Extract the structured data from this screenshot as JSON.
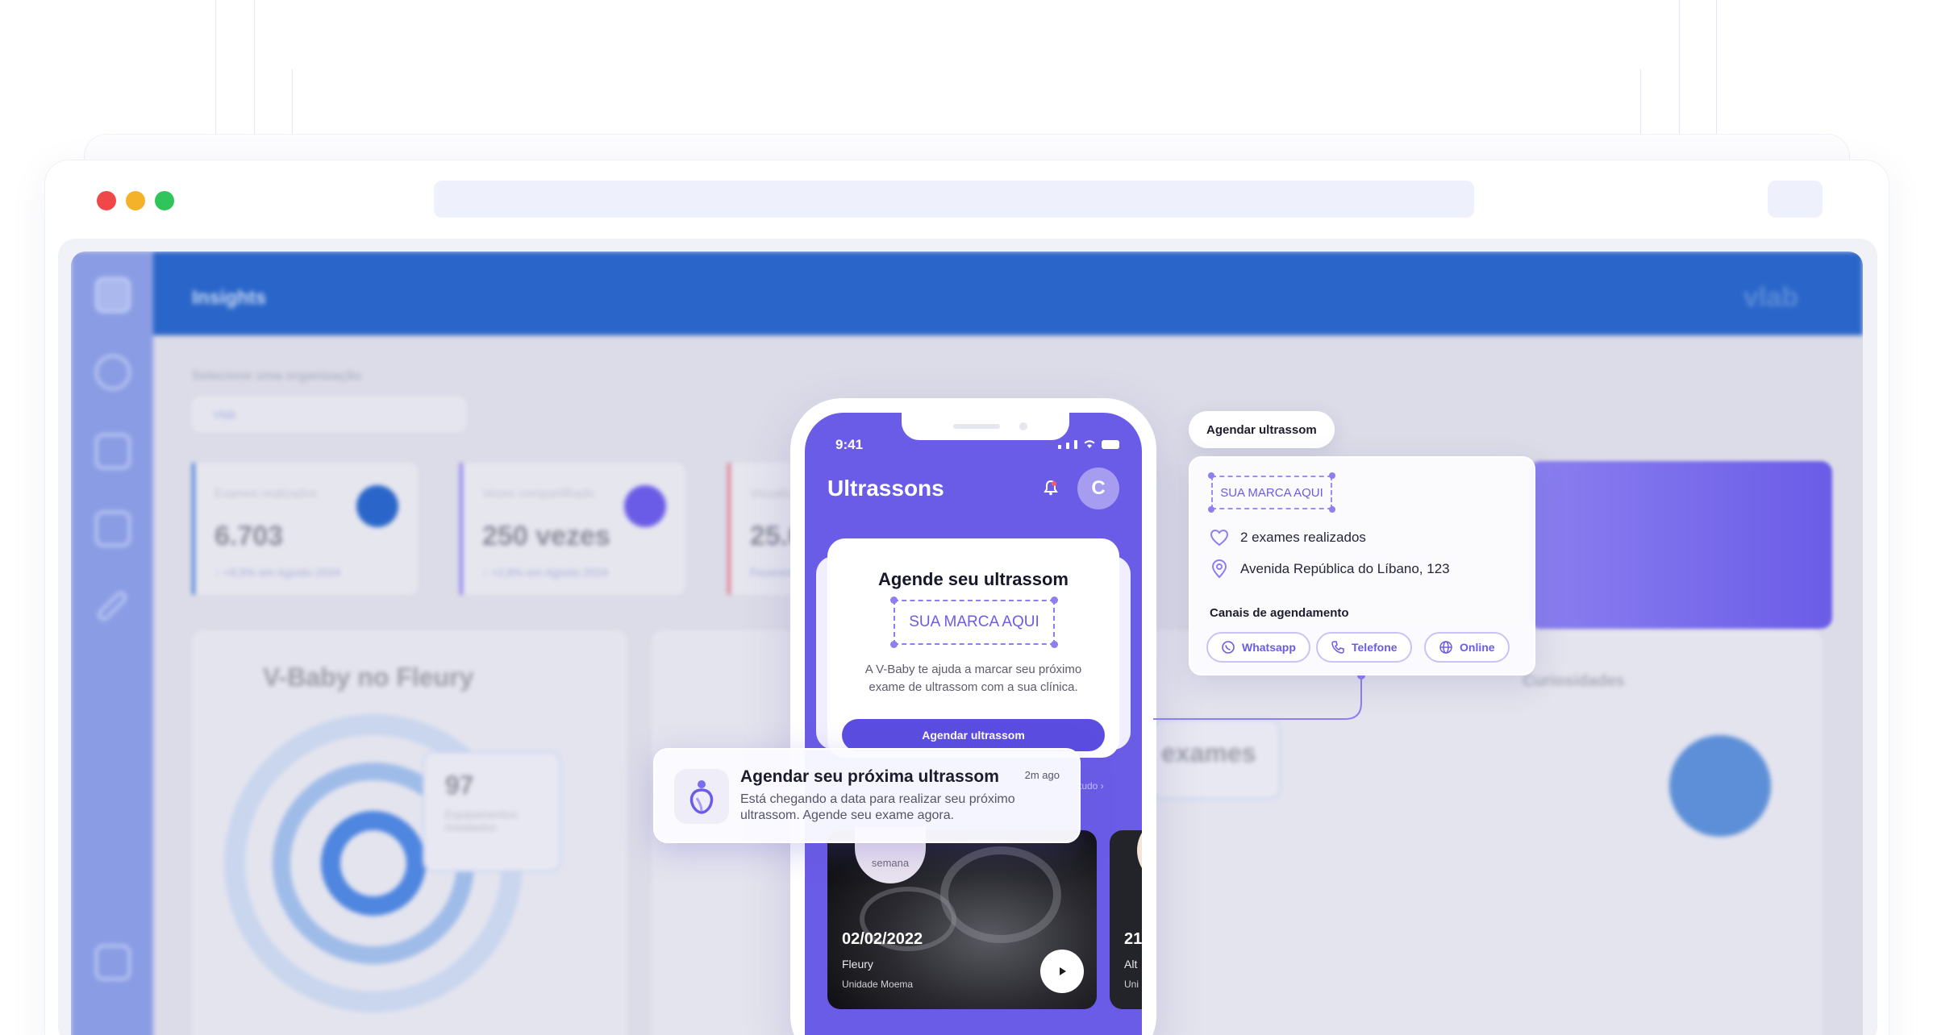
{
  "window": {
    "traffic_lights": [
      "#f04848",
      "#f4b22a",
      "#2fc55a"
    ]
  },
  "dashboard": {
    "header_title": "Insights",
    "header_logo": "vlab",
    "org_label": "Selecione uma organização",
    "org_value": "Vlab",
    "cards": [
      {
        "label": "Exames realizados",
        "value": "6.703",
        "trend": "↑ +8,5% em Agosto 2024",
        "accent": "#2a66c9"
      },
      {
        "label": "Vezes compartilhado",
        "value": "250 vezes",
        "trend": "↑ +2,8% em Agosto 2024",
        "accent": "#6b5ce7"
      },
      {
        "label": "Visualizações",
        "value": "25.0",
        "trend": "Fevereiro",
        "accent": "#e0556b"
      }
    ],
    "chart_title": "V-Baby no Fleury",
    "equip_value": "97",
    "equip_label": "Equipamentos instalados",
    "exams_heading": "exames",
    "curiosities_title": "Curiosidades"
  },
  "phone": {
    "time": "9:41",
    "title": "Ultrassons",
    "avatar_letter": "C",
    "card": {
      "title": "Agende seu ultrassom",
      "brand_placeholder": "SUA MARCA AQUI",
      "description": "A V-Baby te ajuda a marcar seu próximo exame de ultrassom com a sua clínica.",
      "cta": "Agendar ultrassom"
    },
    "see_all": "tudo ›",
    "videos": [
      {
        "week": "semana",
        "date": "02/02/2022",
        "place": "Fleury",
        "unit": "Unidade Moema"
      },
      {
        "date": "21",
        "place": "Alt",
        "unit": "Uni"
      }
    ]
  },
  "notification": {
    "title": "Agendar seu próxima ultrassom",
    "time": "2m ago",
    "body": "Está chegando a data para realizar seu próximo ultrassom. Agende seu exame agora."
  },
  "callout": {
    "pill": "Agendar ultrassom",
    "brand_placeholder": "SUA MARCA AQUI",
    "exams": "2 exames realizados",
    "address": "Avenida República do Líbano, 123",
    "channels_title": "Canais de agendamento",
    "channels": [
      "Whatsapp",
      "Telefone",
      "Online"
    ]
  },
  "colors": {
    "primary": "#6b5ce7",
    "dashboard_blue": "#2a66c9"
  }
}
